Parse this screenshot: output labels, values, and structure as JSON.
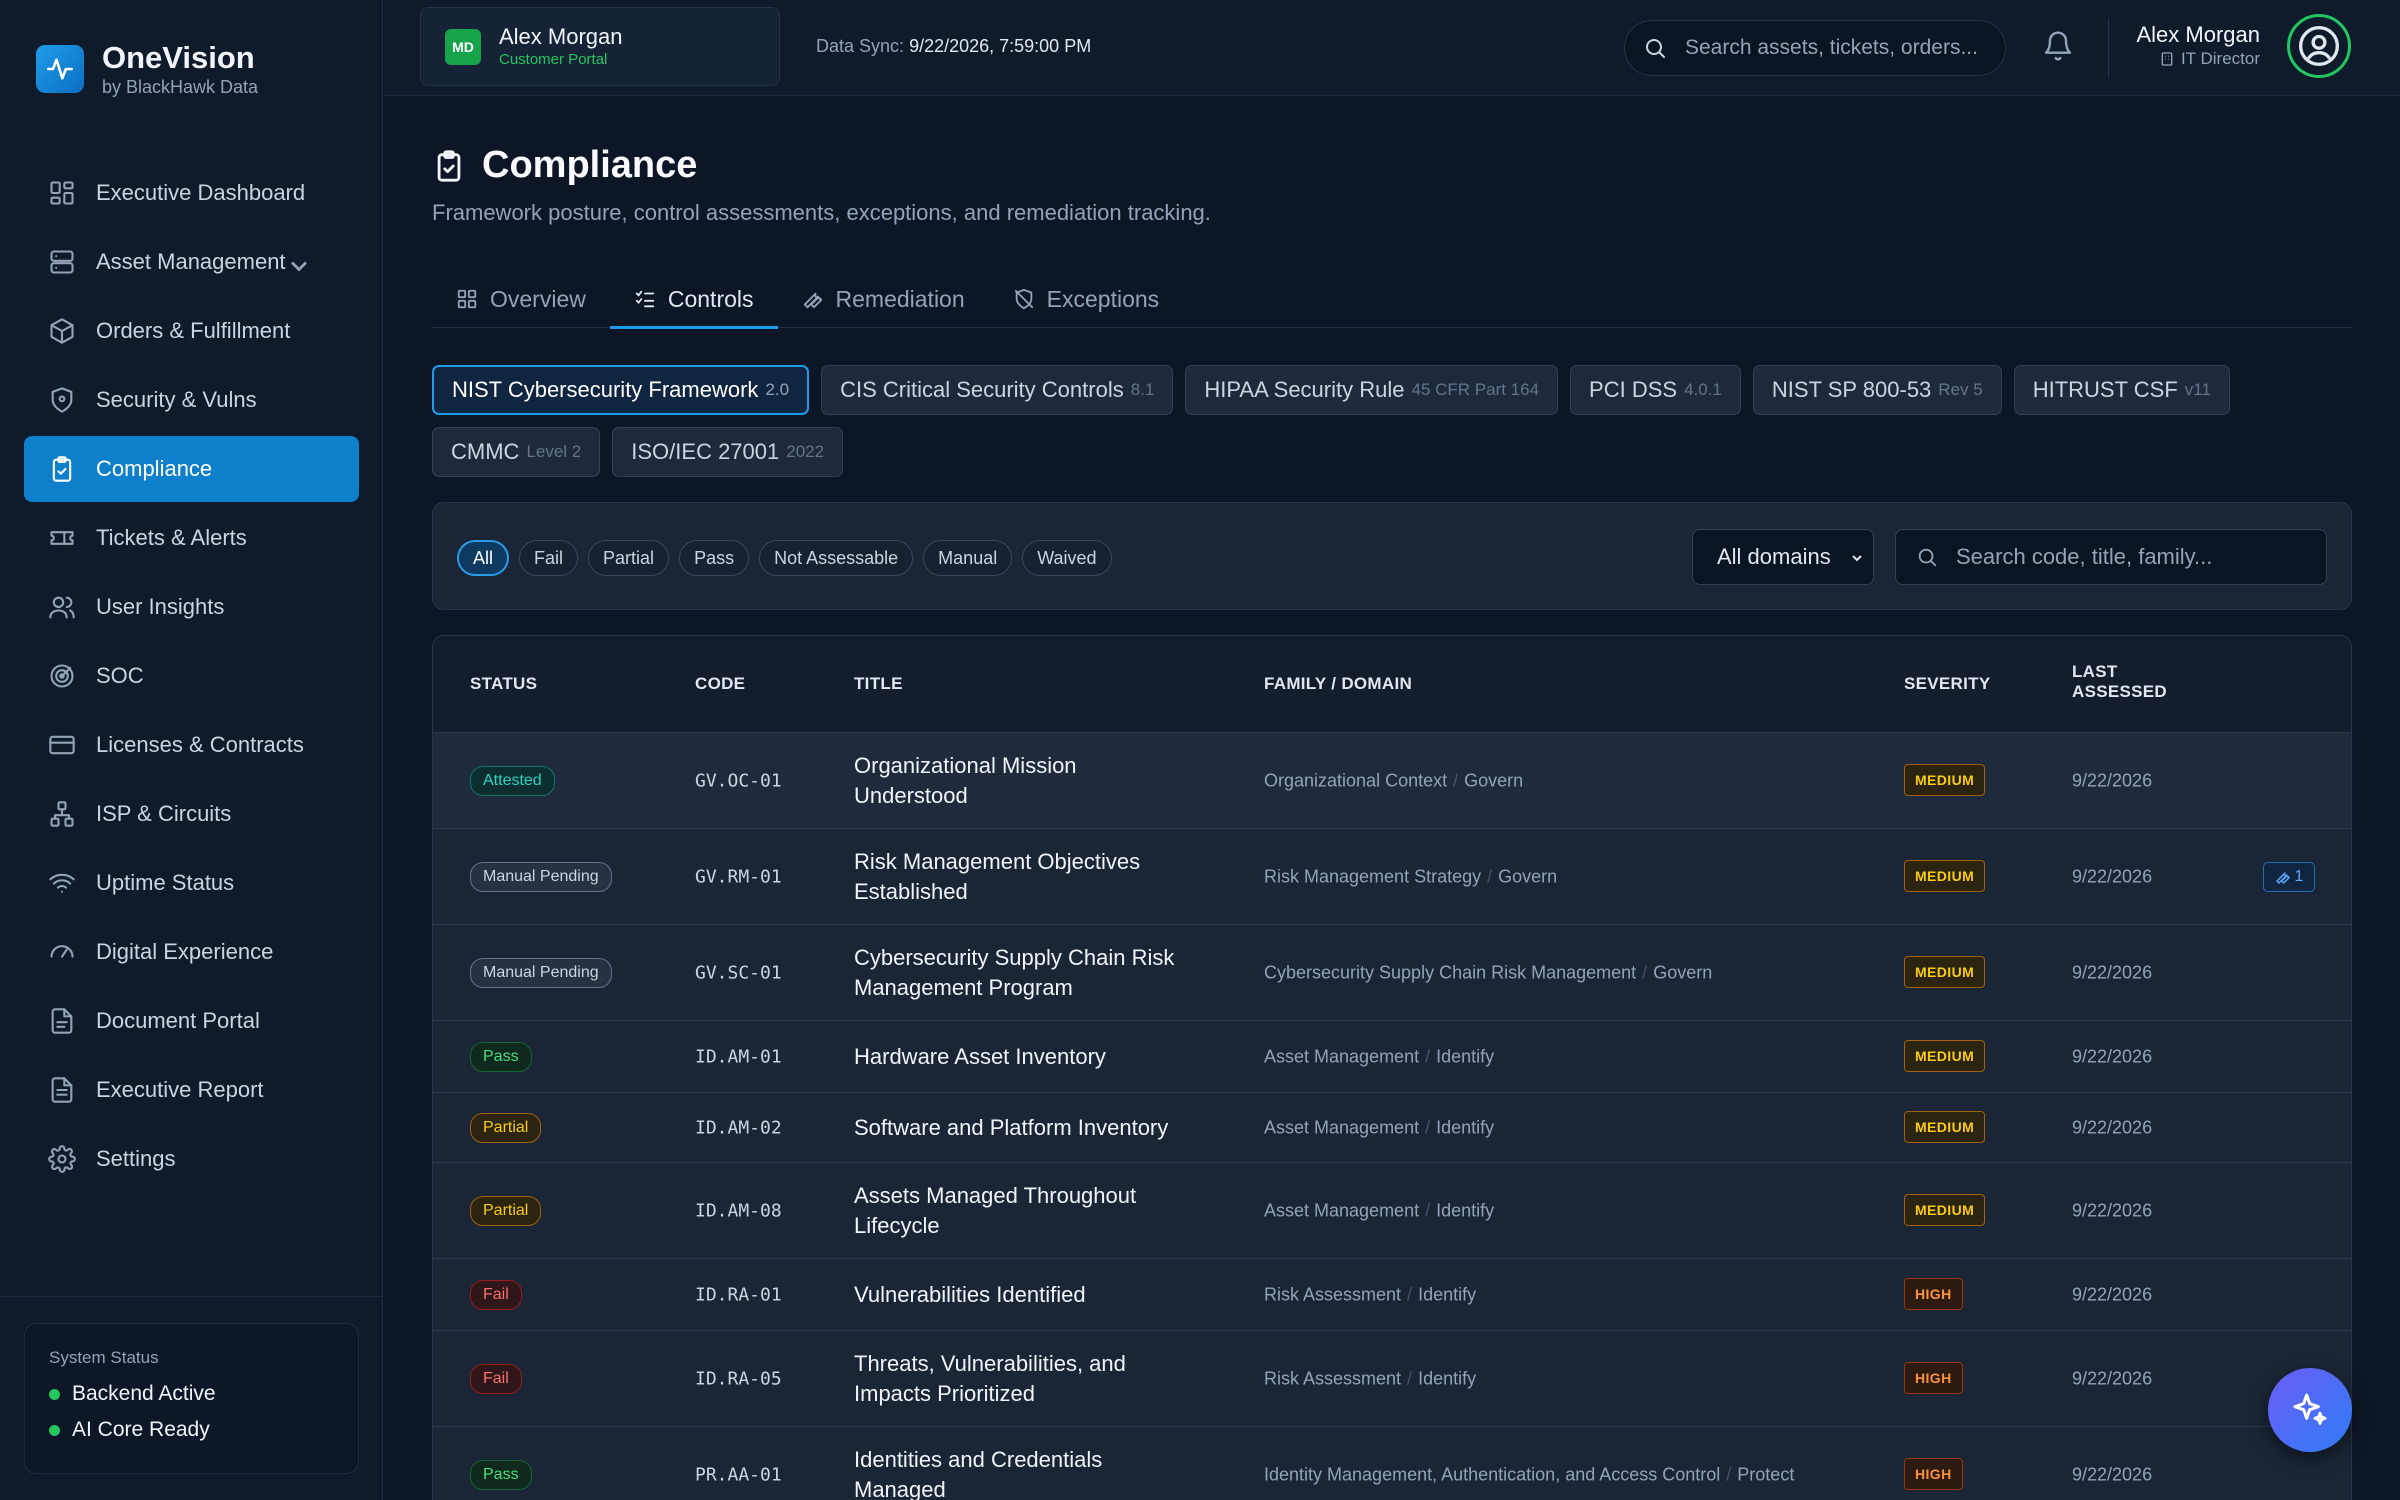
{
  "brand": {
    "name": "OneVision",
    "sub": "by BlackHawk Data"
  },
  "nav": [
    {
      "label": "Executive Dashboard",
      "icon": "dashboard-icon"
    },
    {
      "label": "Asset Management",
      "icon": "server-icon"
    },
    {
      "label": "Orders & Fulfillment",
      "icon": "package-icon"
    },
    {
      "label": "Security & Vulns",
      "icon": "shield-icon"
    },
    {
      "label": "Compliance",
      "icon": "clipboard-check-icon",
      "active": true
    },
    {
      "label": "Tickets & Alerts",
      "icon": "ticket-icon"
    },
    {
      "label": "User Insights",
      "icon": "users-icon"
    },
    {
      "label": "SOC",
      "icon": "radar-icon"
    },
    {
      "label": "Licenses & Contracts",
      "icon": "credit-card-icon"
    },
    {
      "label": "ISP & Circuits",
      "icon": "network-icon"
    },
    {
      "label": "Uptime Status",
      "icon": "wifi-icon"
    },
    {
      "label": "Digital Experience",
      "icon": "gauge-icon"
    },
    {
      "label": "Document Portal",
      "icon": "document-icon"
    },
    {
      "label": "Executive Report",
      "icon": "report-icon"
    },
    {
      "label": "Settings",
      "icon": "gear-icon"
    }
  ],
  "system_status": {
    "title": "System Status",
    "items": [
      "Backend Active",
      "AI Core Ready"
    ]
  },
  "topbar": {
    "portal_initials": "MD",
    "portal_name": "Alex Morgan",
    "portal_sub": "Customer Portal",
    "sync_label": "Data Sync:",
    "sync_value": "9/22/2026, 7:59:00 PM",
    "search_placeholder": "Search assets, tickets, orders...",
    "user_name": "Alex Morgan",
    "user_role": "IT Director"
  },
  "page": {
    "title": "Compliance",
    "subtitle": "Framework posture, control assessments, exceptions, and remediation tracking."
  },
  "tabs": [
    "Overview",
    "Controls",
    "Remediation",
    "Exceptions"
  ],
  "frameworks": [
    {
      "name": "NIST Cybersecurity Framework",
      "ver": "2.0",
      "active": true
    },
    {
      "name": "CIS Critical Security Controls",
      "ver": "8.1"
    },
    {
      "name": "HIPAA Security Rule",
      "ver": "45 CFR Part 164"
    },
    {
      "name": "PCI DSS",
      "ver": "4.0.1"
    },
    {
      "name": "NIST SP 800-53",
      "ver": "Rev 5"
    },
    {
      "name": "HITRUST CSF",
      "ver": "v11"
    },
    {
      "name": "CMMC",
      "ver": "Level 2"
    },
    {
      "name": "ISO/IEC 27001",
      "ver": "2022"
    }
  ],
  "filters": {
    "pills": [
      "All",
      "Fail",
      "Partial",
      "Pass",
      "Not Assessable",
      "Manual",
      "Waived"
    ],
    "domain_select": "All domains",
    "search_placeholder": "Search code, title, family..."
  },
  "table": {
    "headers": {
      "status": "STATUS",
      "code": "CODE",
      "title": "TITLE",
      "family": "FAMILY / DOMAIN",
      "severity": "SEVERITY",
      "assessed_1": "LAST",
      "assessed_2": "ASSESSED"
    },
    "rows": [
      {
        "status": "Attested",
        "status_class": "st-attested",
        "code": "GV.OC-01",
        "title": "Organizational Mission Understood",
        "family": "Organizational Context",
        "domain": "Govern",
        "severity": "MEDIUM",
        "sev_class": "sev-medium",
        "date": "9/22/2026"
      },
      {
        "status": "Manual Pending",
        "status_class": "st-manual",
        "code": "GV.RM-01",
        "title": "Risk Management Objectives Established",
        "family": "Risk Management Strategy",
        "domain": "Govern",
        "severity": "MEDIUM",
        "sev_class": "sev-medium",
        "date": "9/22/2026",
        "remediation": "1"
      },
      {
        "status": "Manual Pending",
        "status_class": "st-manual",
        "code": "GV.SC-01",
        "title": "Cybersecurity Supply Chain Risk Management Program",
        "family": "Cybersecurity Supply Chain Risk Management",
        "domain": "Govern",
        "severity": "MEDIUM",
        "sev_class": "sev-medium",
        "date": "9/22/2026"
      },
      {
        "status": "Pass",
        "status_class": "st-pass",
        "code": "ID.AM-01",
        "title": "Hardware Asset Inventory",
        "family": "Asset Management",
        "domain": "Identify",
        "severity": "MEDIUM",
        "sev_class": "sev-medium",
        "date": "9/22/2026"
      },
      {
        "status": "Partial",
        "status_class": "st-partial",
        "code": "ID.AM-02",
        "title": "Software and Platform Inventory",
        "family": "Asset Management",
        "domain": "Identify",
        "severity": "MEDIUM",
        "sev_class": "sev-medium",
        "date": "9/22/2026"
      },
      {
        "status": "Partial",
        "status_class": "st-partial",
        "code": "ID.AM-08",
        "title": "Assets Managed Throughout Lifecycle",
        "family": "Asset Management",
        "domain": "Identify",
        "severity": "MEDIUM",
        "sev_class": "sev-medium",
        "date": "9/22/2026"
      },
      {
        "status": "Fail",
        "status_class": "st-fail",
        "code": "ID.RA-01",
        "title": "Vulnerabilities Identified",
        "family": "Risk Assessment",
        "domain": "Identify",
        "severity": "HIGH",
        "sev_class": "sev-high",
        "date": "9/22/2026"
      },
      {
        "status": "Fail",
        "status_class": "st-fail",
        "code": "ID.RA-05",
        "title": "Threats, Vulnerabilities, and Impacts Prioritized",
        "family": "Risk Assessment",
        "domain": "Identify",
        "severity": "HIGH",
        "sev_class": "sev-high",
        "date": "9/22/2026"
      },
      {
        "status": "Pass",
        "status_class": "st-pass",
        "code": "PR.AA-01",
        "title": "Identities and Credentials Managed",
        "family": "Identity Management, Authentication, and Access Control",
        "domain": "Protect",
        "severity": "HIGH",
        "sev_class": "sev-high",
        "date": "9/22/2026"
      }
    ]
  }
}
